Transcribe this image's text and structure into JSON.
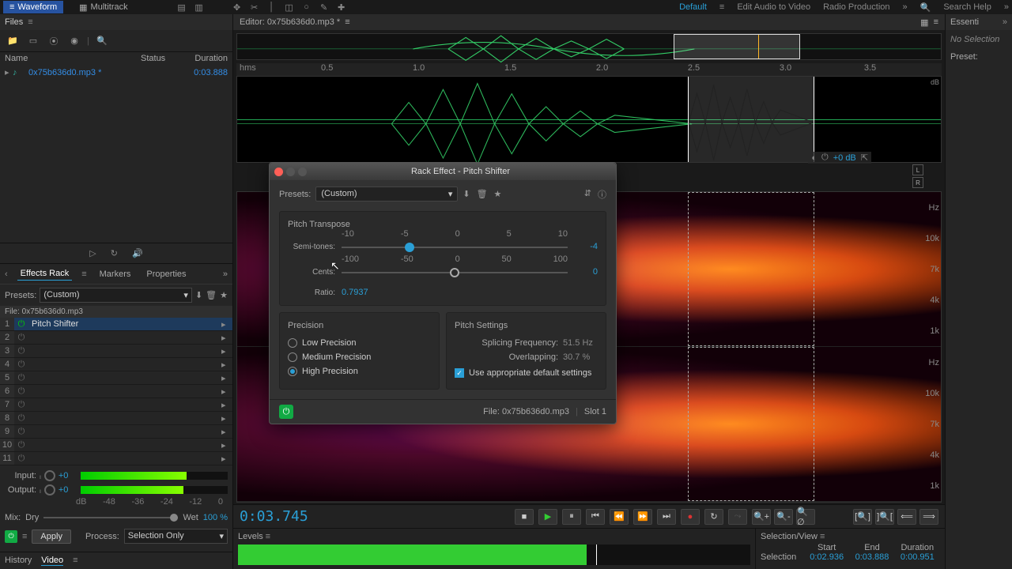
{
  "topbar": {
    "waveform": "Waveform",
    "multitrack": "Multitrack",
    "workspace_default": "Default",
    "edit_audio_video": "Edit Audio to Video",
    "radio_production": "Radio Production",
    "search_help": "Search Help"
  },
  "files": {
    "header": "Files",
    "columns": {
      "name": "Name",
      "status": "Status",
      "duration": "Duration"
    },
    "items": [
      {
        "name": "0x75b636d0.mp3 *",
        "duration": "0:03.888"
      }
    ]
  },
  "rack": {
    "tabs": {
      "effects_rack": "Effects Rack",
      "markers": "Markers",
      "properties": "Properties"
    },
    "presets_label": "Presets:",
    "preset_value": "(Custom)",
    "file_label": "File: 0x75b636d0.mp3",
    "slots": [
      {
        "num": "1",
        "name": "Pitch Shifter",
        "power": true
      },
      {
        "num": "2",
        "name": "",
        "power": false
      },
      {
        "num": "3",
        "name": "",
        "power": false
      },
      {
        "num": "4",
        "name": "",
        "power": false
      },
      {
        "num": "5",
        "name": "",
        "power": false
      },
      {
        "num": "6",
        "name": "",
        "power": false
      },
      {
        "num": "7",
        "name": "",
        "power": false
      },
      {
        "num": "8",
        "name": "",
        "power": false
      },
      {
        "num": "9",
        "name": "",
        "power": false
      },
      {
        "num": "10",
        "name": "",
        "power": false
      },
      {
        "num": "11",
        "name": "",
        "power": false
      }
    ],
    "io": {
      "input_label": "Input:",
      "output_label": "Output:",
      "input_val": "+0",
      "output_val": "+0",
      "db_ticks": [
        "dB",
        "-48",
        "-36",
        "-24",
        "-12",
        "0"
      ]
    },
    "mix": {
      "label": "Mix:",
      "dry": "Dry",
      "wet": "Wet",
      "value": "100 %"
    },
    "apply": {
      "apply": "Apply",
      "process": "Process:",
      "process_value": "Selection Only"
    },
    "bottom_tabs": {
      "history": "History",
      "video": "Video"
    }
  },
  "editor": {
    "header": "Editor: 0x75b636d0.mp3 *",
    "ruler": [
      "hms",
      "0.5",
      "1.0",
      "1.5",
      "2.0",
      "2.5",
      "3.0",
      "3.5"
    ],
    "db_label": "dB",
    "hz_label": "Hz",
    "hz_ticks_top": [
      "10k",
      "7k",
      "4k",
      "1k"
    ],
    "lr": {
      "l": "L",
      "r": "R"
    },
    "vol_readout": "+0 dB"
  },
  "transport": {
    "time": "0:03.745"
  },
  "levels": {
    "header": "Levels"
  },
  "selview": {
    "header": "Selection/View",
    "cols": {
      "start": "Start",
      "end": "End",
      "duration": "Duration"
    },
    "selection_label": "Selection",
    "sel": {
      "start": "0:02.936",
      "end": "0:03.888",
      "duration": "0:00.951"
    }
  },
  "right": {
    "header": "Essenti",
    "no_selection": "No Selection",
    "preset_label": "Preset:"
  },
  "dialog": {
    "title": "Rack Effect - Pitch Shifter",
    "presets_label": "Presets:",
    "preset_value": "(Custom)",
    "pitch_transpose": "Pitch Transpose",
    "semitones_label": "Semi-tones:",
    "semitones_ticks": [
      "-10",
      "-5",
      "0",
      "5",
      "10"
    ],
    "semitones_value": "-4",
    "cents_label": "Cents:",
    "cents_ticks": [
      "-100",
      "-50",
      "0",
      "50",
      "100"
    ],
    "cents_value": "0",
    "ratio_label": "Ratio:",
    "ratio_value": "0.7937",
    "precision": {
      "title": "Precision",
      "low": "Low Precision",
      "medium": "Medium Precision",
      "high": "High Precision"
    },
    "pitch_settings": {
      "title": "Pitch Settings",
      "splicing_label": "Splicing Frequency:",
      "splicing_value": "51.5 Hz",
      "overlap_label": "Overlapping:",
      "overlap_value": "30.7 %",
      "use_defaults": "Use appropriate default settings"
    },
    "footer": {
      "file": "File: 0x75b636d0.mp3",
      "slot": "Slot 1"
    }
  }
}
